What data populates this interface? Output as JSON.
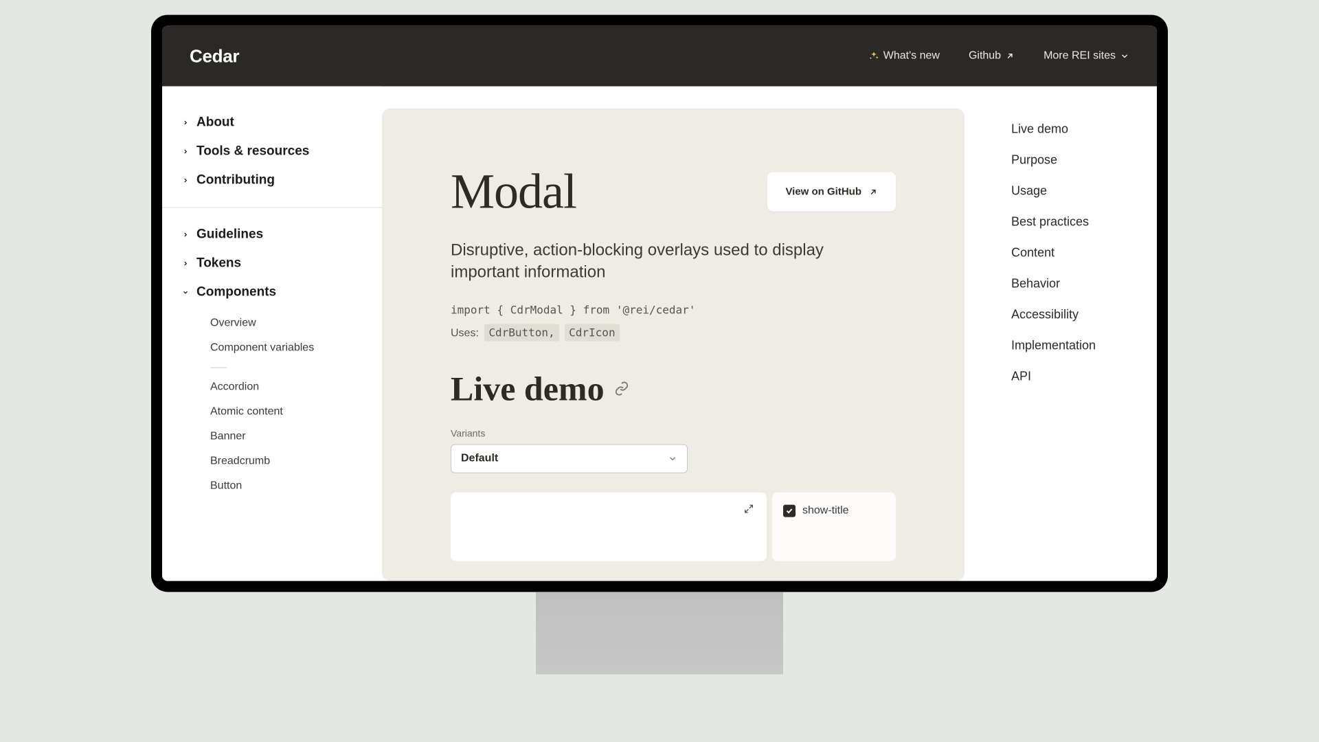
{
  "header": {
    "logo": "Cedar",
    "nav": {
      "whats_new": "What's new",
      "github": "Github",
      "more_sites": "More REI sites"
    }
  },
  "sidebar": {
    "top": [
      {
        "label": "About",
        "expanded": false
      },
      {
        "label": "Tools & resources",
        "expanded": false
      },
      {
        "label": "Contributing",
        "expanded": false
      }
    ],
    "bottom": [
      {
        "label": "Guidelines",
        "expanded": false
      },
      {
        "label": "Tokens",
        "expanded": false
      },
      {
        "label": "Components",
        "expanded": true
      }
    ],
    "components_sub_top": [
      "Overview",
      "Component variables"
    ],
    "components_sub_list": [
      "Accordion",
      "Atomic content",
      "Banner",
      "Breadcrumb",
      "Button"
    ]
  },
  "content": {
    "title": "Modal",
    "github_button": "View on GitHub",
    "description": "Disruptive, action-blocking overlays used to display important information",
    "import_line": "import { CdrModal } from '@rei/cedar'",
    "uses_label": "Uses:",
    "uses_tags": [
      "CdrButton,",
      "CdrIcon"
    ],
    "section_title": "Live demo",
    "variants_label": "Variants",
    "variants_selected": "Default",
    "checkbox_label": "show-title"
  },
  "toc": [
    "Live demo",
    "Purpose",
    "Usage",
    "Best practices",
    "Content",
    "Behavior",
    "Accessibility",
    "Implementation",
    "API"
  ]
}
